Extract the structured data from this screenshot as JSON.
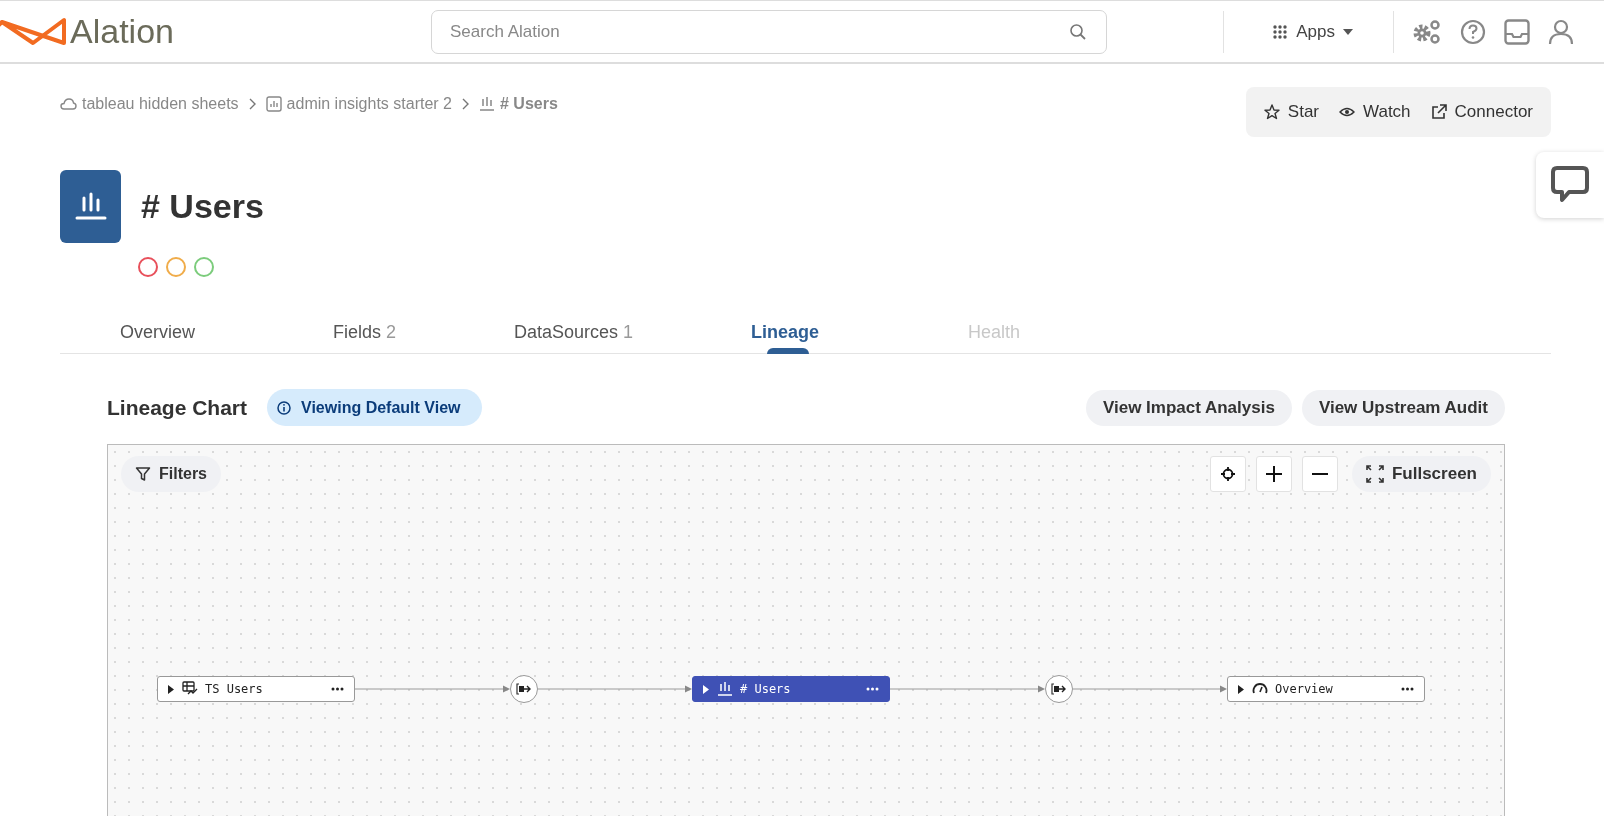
{
  "header": {
    "logo": "Alation",
    "search": {
      "placeholder": "Search Alation"
    },
    "apps_label": "Apps"
  },
  "breadcrumb": [
    {
      "kind": "cloud",
      "label": "tableau hidden sheets"
    },
    {
      "kind": "workbook",
      "label": "admin insights starter 2"
    },
    {
      "kind": "sheet",
      "label": "# Users",
      "current": true
    }
  ],
  "actions": [
    {
      "kind": "star",
      "label": "Star"
    },
    {
      "kind": "watch",
      "label": "Watch"
    },
    {
      "kind": "connector",
      "label": "Connector"
    }
  ],
  "title": "# Users",
  "trust_flags": [
    {
      "color": "#e8505b"
    },
    {
      "color": "#f0ac4a"
    },
    {
      "color": "#7ccc7c"
    }
  ],
  "tabs": [
    {
      "label": "Overview",
      "selected": false,
      "disabled": false
    },
    {
      "label": "Fields",
      "count": "2",
      "selected": false,
      "disabled": false
    },
    {
      "label": "DataSources",
      "count": "1",
      "selected": false,
      "disabled": false
    },
    {
      "label": "Lineage",
      "selected": true,
      "disabled": false
    },
    {
      "label": "Health",
      "selected": false,
      "disabled": true
    }
  ],
  "lineage": {
    "heading": "Lineage Chart",
    "view_badge": "Viewing Default View",
    "buttons": [
      "View Impact Analysis",
      "View Upstream Audit"
    ],
    "filters_label": "Filters",
    "fullscreen_label": "Fullscreen",
    "nodes": [
      {
        "kind": "datasource",
        "label": "TS Users",
        "selected": false
      },
      {
        "kind": "transform"
      },
      {
        "kind": "sheet",
        "label": "# Users",
        "selected": true
      },
      {
        "kind": "transform"
      },
      {
        "kind": "dashboard",
        "label": "Overview",
        "selected": false
      }
    ]
  }
}
